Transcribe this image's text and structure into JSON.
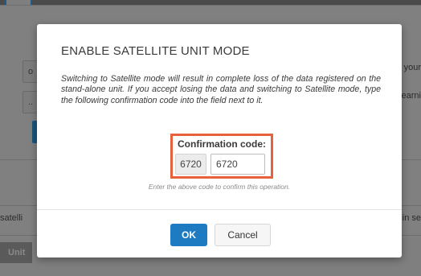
{
  "background": {
    "input_1_value": "o",
    "input_2_value": "..",
    "right_text_1": "your",
    "right_text_2": "earni",
    "satellite_left": "satelli",
    "satellite_right": "in se",
    "unit_button": "Unit"
  },
  "modal": {
    "title": "ENABLE SATELLITE UNIT MODE",
    "body": "Switching to Satellite mode will result in complete loss of the data registered on the stand-alone unit. If you accept losing the data and switching to Satellite mode, type the following confirmation code into the field next to it.",
    "confirmation_label": "Confirmation code:",
    "confirmation_code": "6720",
    "input_value": "6720",
    "hint": "Enter the above code to confirm this operation.",
    "ok_label": "OK",
    "cancel_label": "Cancel"
  },
  "colors": {
    "primary_button": "#1e7bc2",
    "highlight_border": "#e8603c",
    "overlay": "#808080"
  }
}
